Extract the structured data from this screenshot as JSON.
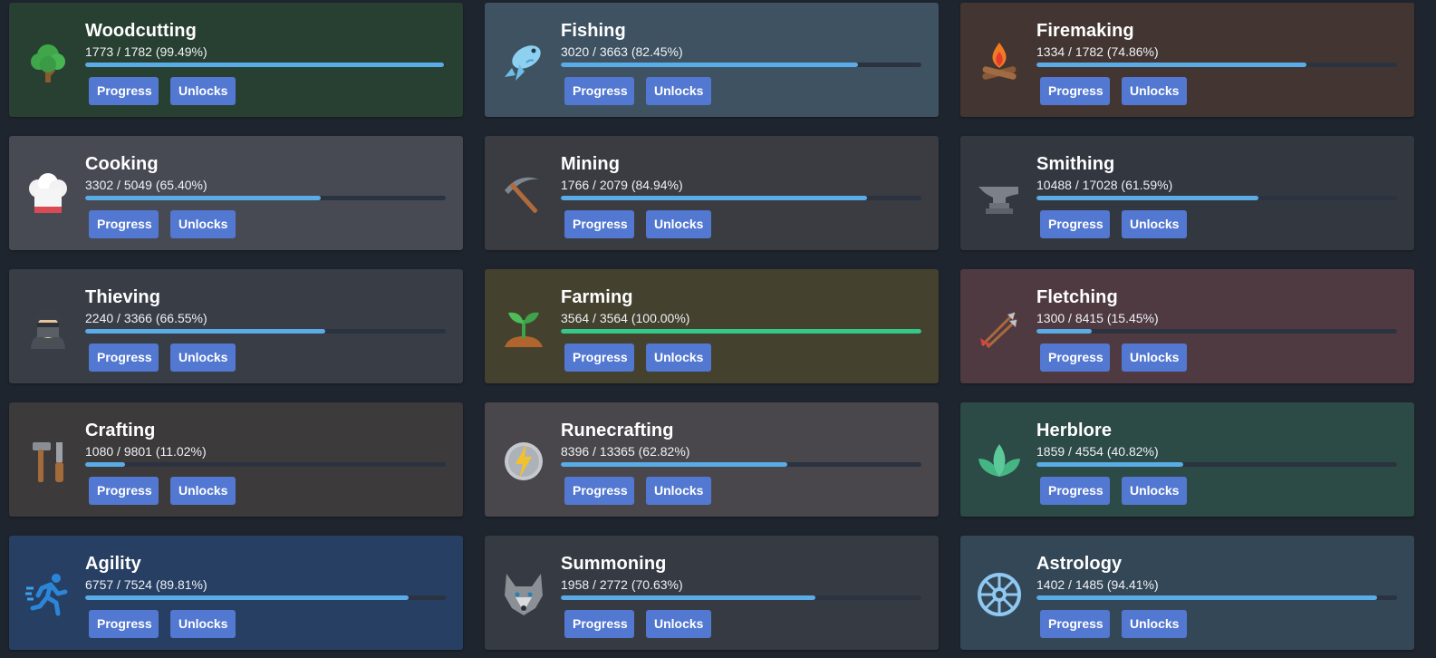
{
  "skills": [
    {
      "key": "woodcutting",
      "name": "Woodcutting",
      "stats": "1773 / 1782 (99.49%)",
      "progress": 0.9949,
      "bg": "#284031",
      "icon": "tree-icon",
      "progress_label": "Progress",
      "unlocks_label": "Unlocks"
    },
    {
      "key": "fishing",
      "name": "Fishing",
      "stats": "3020 / 3663 (82.45%)",
      "progress": 0.8245,
      "bg": "#3e5262",
      "icon": "fish-icon",
      "progress_label": "Progress",
      "unlocks_label": "Unlocks"
    },
    {
      "key": "firemaking",
      "name": "Firemaking",
      "stats": "1334 / 1782 (74.86%)",
      "progress": 0.7486,
      "bg": "#433632",
      "icon": "campfire-icon",
      "progress_label": "Progress",
      "unlocks_label": "Unlocks"
    },
    {
      "key": "cooking",
      "name": "Cooking",
      "stats": "3302 / 5049 (65.40%)",
      "progress": 0.654,
      "bg": "#474a53",
      "icon": "chef-hat-icon",
      "progress_label": "Progress",
      "unlocks_label": "Unlocks"
    },
    {
      "key": "mining",
      "name": "Mining",
      "stats": "1766 / 2079 (84.94%)",
      "progress": 0.8494,
      "bg": "#3a3c41",
      "icon": "pickaxe-icon",
      "progress_label": "Progress",
      "unlocks_label": "Unlocks"
    },
    {
      "key": "smithing",
      "name": "Smithing",
      "stats": "10488 / 17028 (61.59%)",
      "progress": 0.6159,
      "bg": "#33373f",
      "icon": "anvil-icon",
      "progress_label": "Progress",
      "unlocks_label": "Unlocks"
    },
    {
      "key": "thieving",
      "name": "Thieving",
      "stats": "2240 / 3366 (66.55%)",
      "progress": 0.6655,
      "bg": "#383d46",
      "icon": "thief-icon",
      "progress_label": "Progress",
      "unlocks_label": "Unlocks"
    },
    {
      "key": "farming",
      "name": "Farming",
      "stats": "3564 / 3564 (100.00%)",
      "progress": 1.0,
      "bg": "#44412f",
      "icon": "sprout-icon",
      "progress_label": "Progress",
      "unlocks_label": "Unlocks",
      "complete": true
    },
    {
      "key": "fletching",
      "name": "Fletching",
      "stats": "1300 / 8415 (15.45%)",
      "progress": 0.1545,
      "bg": "#4f3a42",
      "icon": "arrows-icon",
      "progress_label": "Progress",
      "unlocks_label": "Unlocks"
    },
    {
      "key": "crafting",
      "name": "Crafting",
      "stats": "1080 / 9801 (11.02%)",
      "progress": 0.1102,
      "bg": "#3c3a3a",
      "icon": "hammer-knife-icon",
      "progress_label": "Progress",
      "unlocks_label": "Unlocks"
    },
    {
      "key": "runecrafting",
      "name": "Runecrafting",
      "stats": "8396 / 13365 (62.82%)",
      "progress": 0.6282,
      "bg": "#49474c",
      "icon": "rune-icon",
      "progress_label": "Progress",
      "unlocks_label": "Unlocks"
    },
    {
      "key": "herblore",
      "name": "Herblore",
      "stats": "1859 / 4554 (40.82%)",
      "progress": 0.4082,
      "bg": "#2c4a46",
      "icon": "leaves-icon",
      "progress_label": "Progress",
      "unlocks_label": "Unlocks"
    },
    {
      "key": "agility",
      "name": "Agility",
      "stats": "6757 / 7524 (89.81%)",
      "progress": 0.8981,
      "bg": "#263f62",
      "icon": "runner-icon",
      "progress_label": "Progress",
      "unlocks_label": "Unlocks"
    },
    {
      "key": "summoning",
      "name": "Summoning",
      "stats": "1958 / 2772 (70.63%)",
      "progress": 0.7063,
      "bg": "#363b43",
      "icon": "wolf-icon",
      "progress_label": "Progress",
      "unlocks_label": "Unlocks"
    },
    {
      "key": "astrology",
      "name": "Astrology",
      "stats": "1402 / 1485 (94.41%)",
      "progress": 0.9441,
      "bg": "#344756",
      "icon": "star-wheel-icon",
      "progress_label": "Progress",
      "unlocks_label": "Unlocks"
    }
  ],
  "colors": {
    "bar_fill": "#5aace6",
    "bar_complete": "#34c98a",
    "bar_track": "#2b3340",
    "button": "#5378d1",
    "page_bg": "#1f252e"
  }
}
